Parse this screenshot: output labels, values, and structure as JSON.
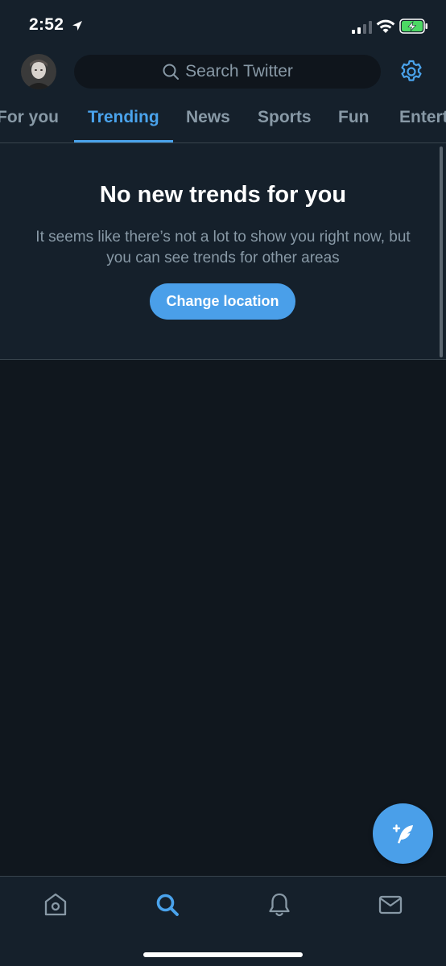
{
  "status_bar": {
    "time": "2:52"
  },
  "header": {
    "search_placeholder": "Search Twitter"
  },
  "tabs": [
    {
      "label": "For you",
      "active": false
    },
    {
      "label": "Trending",
      "active": true
    },
    {
      "label": "News",
      "active": false
    },
    {
      "label": "Sports",
      "active": false
    },
    {
      "label": "Fun",
      "active": false
    },
    {
      "label": "Entert",
      "active": false
    }
  ],
  "empty_state": {
    "title": "No new trends for you",
    "body": "It seems like there’s not a lot to show you right now, but you can see trends for other areas",
    "button_label": "Change location"
  },
  "bottom_nav": {
    "items": [
      "home-icon",
      "search-icon",
      "notifications-icon",
      "messages-icon"
    ],
    "active": "search-icon"
  },
  "colors": {
    "accent": "#4aa3ec",
    "background": "#15202b",
    "secondary_text": "#8899a6"
  }
}
